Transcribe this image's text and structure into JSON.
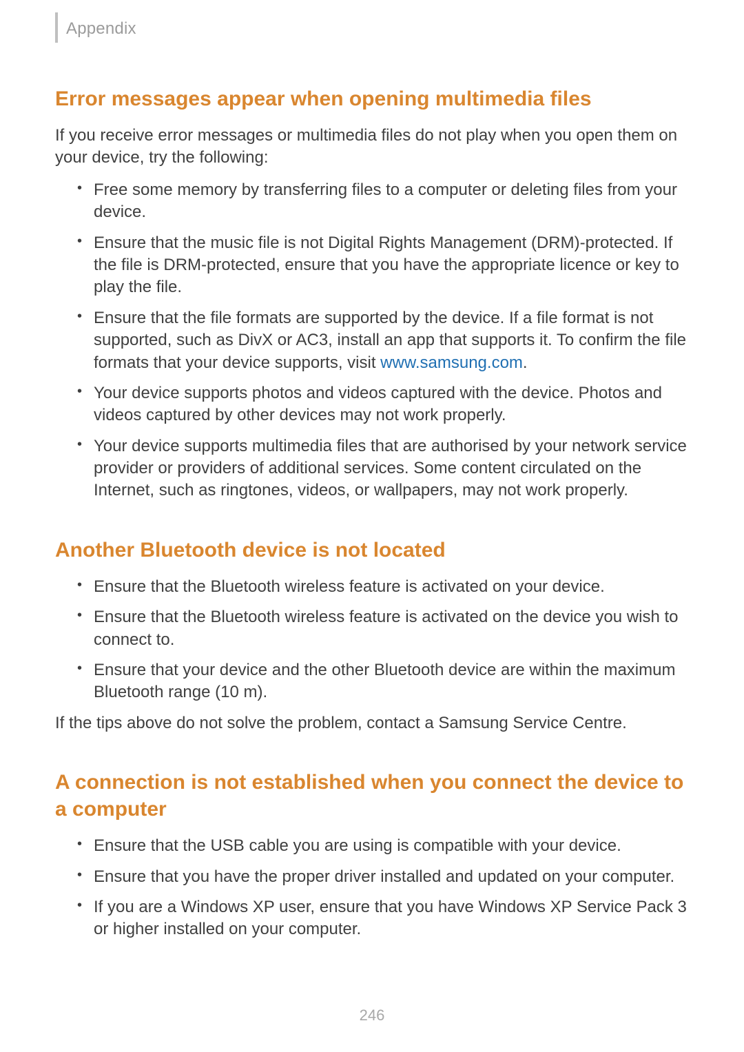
{
  "header": {
    "breadcrumb": "Appendix"
  },
  "sections": {
    "multimedia": {
      "heading": "Error messages appear when opening multimedia files",
      "intro": "If you receive error messages or multimedia files do not play when you open them on your device, try the following:",
      "bullets": {
        "b0": "Free some memory by transferring files to a computer or deleting files from your device.",
        "b1": "Ensure that the music file is not Digital Rights Management (DRM)-protected. If the file is DRM-protected, ensure that you have the appropriate licence or key to play the file.",
        "b2_pre": "Ensure that the file formats are supported by the device. If a file format is not supported, such as DivX or AC3, install an app that supports it. To confirm the file formats that your device supports, visit ",
        "b2_link": "www.samsung.com",
        "b2_post": ".",
        "b3": "Your device supports photos and videos captured with the device. Photos and videos captured by other devices may not work properly.",
        "b4": "Your device supports multimedia files that are authorised by your network service provider or providers of additional services. Some content circulated on the Internet, such as ringtones, videos, or wallpapers, may not work properly."
      }
    },
    "bluetooth": {
      "heading": "Another Bluetooth device is not located",
      "bullets": {
        "b0": "Ensure that the Bluetooth wireless feature is activated on your device.",
        "b1": "Ensure that the Bluetooth wireless feature is activated on the device you wish to connect to.",
        "b2": "Ensure that your device and the other Bluetooth device are within the maximum Bluetooth range (10 m)."
      },
      "closing": "If the tips above do not solve the problem, contact a Samsung Service Centre."
    },
    "connection": {
      "heading": "A connection is not established when you connect the device to a computer",
      "bullets": {
        "b0": "Ensure that the USB cable you are using is compatible with your device.",
        "b1": "Ensure that you have the proper driver installed and updated on your computer.",
        "b2": "If you are a Windows XP user, ensure that you have Windows XP Service Pack 3 or higher installed on your computer."
      }
    }
  },
  "page_number": "246"
}
